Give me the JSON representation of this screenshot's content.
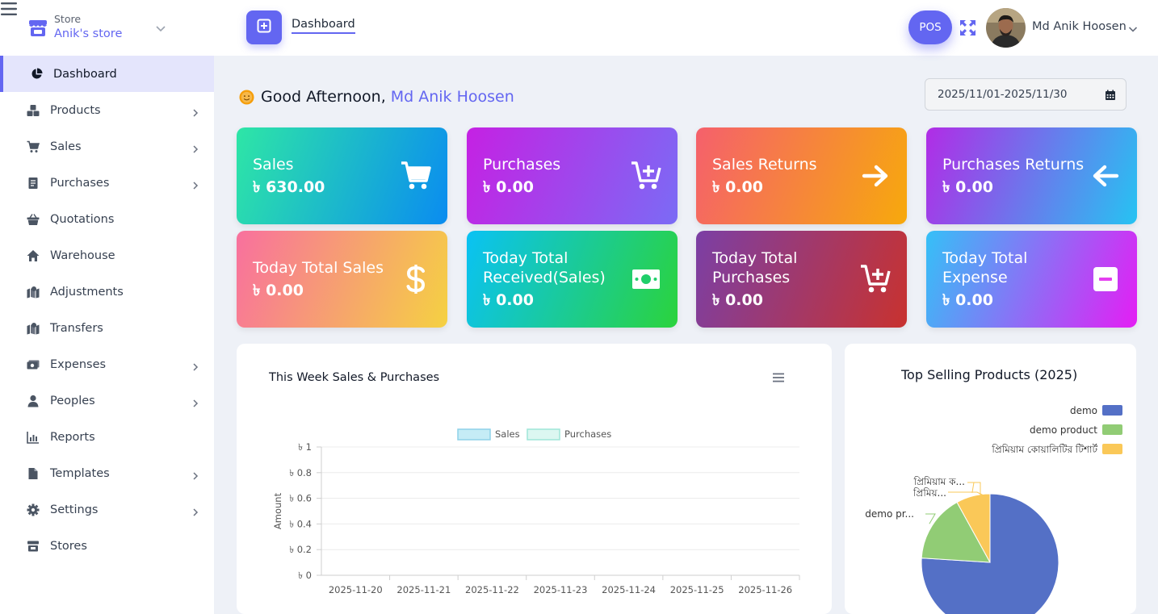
{
  "header": {
    "store_label": "Store",
    "store_name": "Anik's store",
    "breadcrumb": "Dashboard",
    "pos_label": "POS",
    "user_name": "Md Anik Hoosen"
  },
  "sidebar": {
    "items": [
      {
        "label": "Dashboard",
        "icon": "chart-pie-icon",
        "active": true,
        "submenu": false
      },
      {
        "label": "Products",
        "icon": "boxes-icon",
        "submenu": true
      },
      {
        "label": "Sales",
        "icon": "cart-icon",
        "submenu": true
      },
      {
        "label": "Purchases",
        "icon": "receipt-icon",
        "submenu": true
      },
      {
        "label": "Quotations",
        "icon": "basket-icon",
        "submenu": false
      },
      {
        "label": "Warehouse",
        "icon": "house-icon",
        "submenu": false
      },
      {
        "label": "Adjustments",
        "icon": "map-icon",
        "submenu": false
      },
      {
        "label": "Transfers",
        "icon": "map-icon",
        "submenu": false
      },
      {
        "label": "Expenses",
        "icon": "money-icon",
        "submenu": true
      },
      {
        "label": "Peoples",
        "icon": "user-icon",
        "submenu": true
      },
      {
        "label": "Reports",
        "icon": "bar-chart-icon",
        "submenu": false
      },
      {
        "label": "Templates",
        "icon": "file-icon",
        "submenu": true
      },
      {
        "label": "Settings",
        "icon": "gear-icon",
        "submenu": true
      },
      {
        "label": "Stores",
        "icon": "store-icon",
        "submenu": false
      }
    ]
  },
  "greeting": {
    "text": "Good Afternoon,",
    "name": "Md Anik Hoosen"
  },
  "date_range": "2025/11/01-2025/11/30",
  "cards": [
    {
      "title": "Sales",
      "value": "৳ 630.00",
      "icon": "cart-icon",
      "colors": [
        "#2ee6a6",
        "#0a8cf0"
      ]
    },
    {
      "title": "Purchases",
      "value": "৳ 0.00",
      "icon": "cart-plus-icon",
      "colors": [
        "#c521e3",
        "#7b6bf5"
      ]
    },
    {
      "title": "Sales Returns",
      "value": "৳ 0.00",
      "icon": "arrow-right-icon",
      "colors": [
        "#f5606c",
        "#f7a90c"
      ]
    },
    {
      "title": "Purchases Returns",
      "value": "৳ 0.00",
      "icon": "arrow-left-icon",
      "colors": [
        "#b12ce6",
        "#26c3f2"
      ]
    },
    {
      "title": "Today Total Sales",
      "value": "৳ 0.00",
      "icon": "dollar-icon",
      "colors": [
        "#f8709e",
        "#f5d142"
      ]
    },
    {
      "title": "Today Total\nReceived(Sales)",
      "value": "৳ 0.00",
      "icon": "money-bill-icon",
      "colors": [
        "#0ac2f4",
        "#2bd33c"
      ]
    },
    {
      "title": "Today Total\nPurchases",
      "value": "৳ 0.00",
      "icon": "cart-plus-icon",
      "colors": [
        "#7b3fa5",
        "#c8322f"
      ]
    },
    {
      "title": "Today Total\nExpense",
      "value": "৳ 0.00",
      "icon": "minus-square-icon",
      "colors": [
        "#35c0f7",
        "#e41ef4"
      ]
    }
  ],
  "weekly_chart": {
    "title": "This Week Sales & Purchases",
    "chart_data": {
      "type": "bar",
      "categories": [
        "2025-11-20",
        "2025-11-21",
        "2025-11-22",
        "2025-11-23",
        "2025-11-24",
        "2025-11-25",
        "2025-11-26"
      ],
      "series": [
        {
          "name": "Sales",
          "values": [
            0,
            0,
            0,
            0,
            0,
            0,
            0
          ],
          "color": "#c5ecf6",
          "border": "#8fd2e8"
        },
        {
          "name": "Purchases",
          "values": [
            0,
            0,
            0,
            0,
            0,
            0,
            0
          ],
          "color": "#dcf7f1",
          "border": "#9fe6d8"
        }
      ],
      "ylabel": "Amount",
      "ylim": [
        0,
        1
      ],
      "yticks": [
        "৳ 0",
        "৳ 0.2",
        "৳ 0.4",
        "৳ 0.6",
        "৳ 0.8",
        "৳ 1"
      ],
      "legend": "top"
    }
  },
  "top_products": {
    "title": "Top Selling Products (2025)",
    "chart_data": {
      "type": "pie",
      "labels": [
        "demo",
        "demo product",
        "প্রিমিয়াম কোয়ালিটির টিশার্ট"
      ],
      "values": [
        76,
        16,
        8
      ],
      "colors": [
        "#5470c6",
        "#91cc75",
        "#fac858"
      ],
      "slice_labels": [
        "demo pr...",
        "প্রিমিয়...",
        "প্রিমিয়াম ক..."
      ],
      "legend": "top-right"
    }
  }
}
